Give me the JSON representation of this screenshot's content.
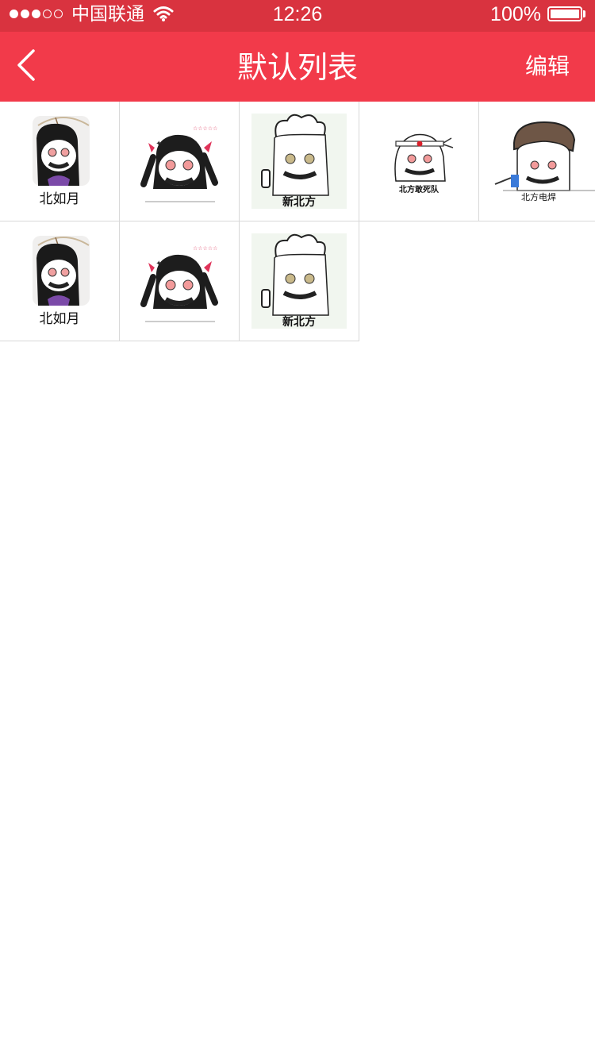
{
  "status_bar": {
    "carrier": "中国联通",
    "time": "12:26",
    "battery": "100%"
  },
  "nav": {
    "title": "默认列表",
    "edit_label": "编辑"
  },
  "stickers": [
    {
      "caption": "北如月",
      "icon": "umbrella-girl-sticker"
    },
    {
      "caption": "",
      "icon": "twintail-girl-sticker"
    },
    {
      "caption": "新北方",
      "icon": "chef-sticker"
    },
    {
      "caption": "北方敢死队",
      "icon": "headband-sticker"
    },
    {
      "caption": "北方电焊",
      "icon": "welder-sticker"
    },
    {
      "caption": "北如月",
      "icon": "umbrella-girl-sticker"
    },
    {
      "caption": "",
      "icon": "twintail-girl-sticker"
    },
    {
      "caption": "新北方",
      "icon": "chef-sticker"
    }
  ]
}
